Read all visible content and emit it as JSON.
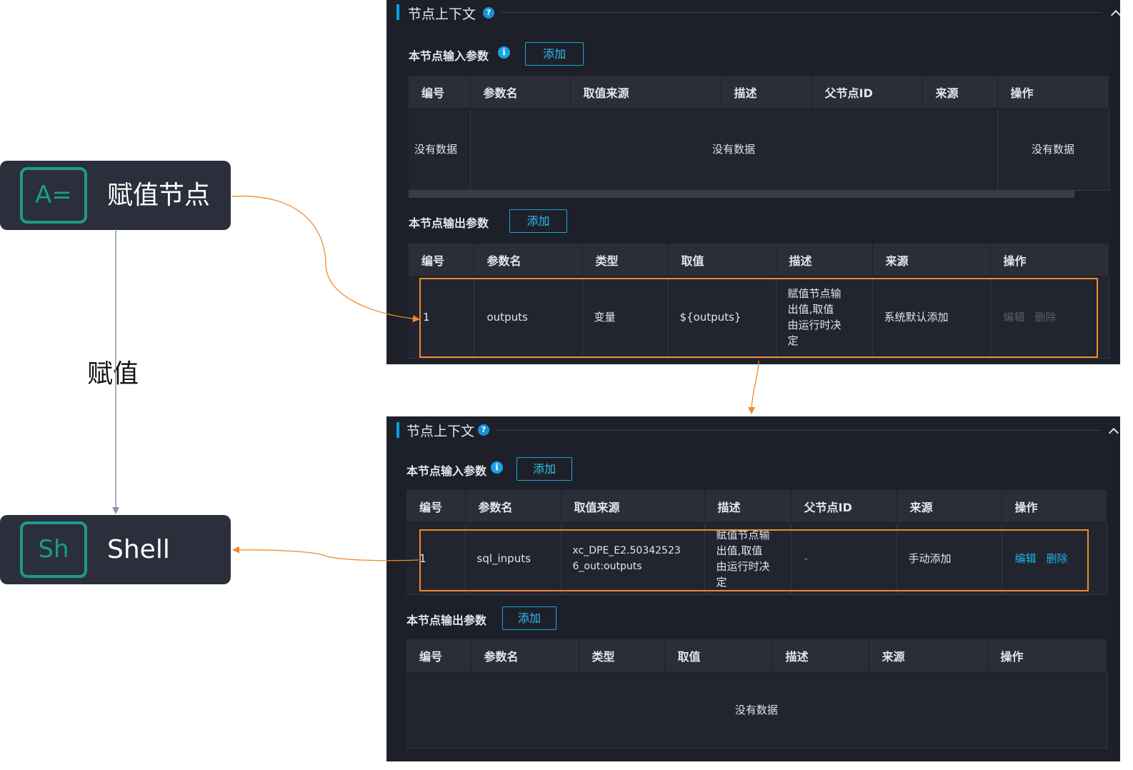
{
  "flow": {
    "node_assign": {
      "icon_text": "A=",
      "label": "赋值节点"
    },
    "node_shell": {
      "icon_text": "Sh",
      "label": "Shell"
    },
    "edge_label": "赋值"
  },
  "colors": {
    "panel_bg": "#1e2029",
    "accent": "#19b4ee",
    "highlight": "#f08a2c",
    "node_teal": "#1e9a8a"
  },
  "icons": [
    "help-icon",
    "info-icon",
    "collapse-up-icon"
  ],
  "top_panel": {
    "title": "节点上下文",
    "input_section": {
      "label": "本节点输入参数",
      "add_label": "添加",
      "columns": [
        "编号",
        "参数名",
        "取值来源",
        "描述",
        "父节点ID",
        "来源",
        "操作"
      ],
      "empty_row": [
        "没有数据",
        "没有数据",
        "没有数据"
      ]
    },
    "output_section": {
      "label": "本节点输出参数",
      "add_label": "添加",
      "columns": [
        "编号",
        "参数名",
        "类型",
        "取值",
        "描述",
        "来源",
        "操作"
      ],
      "rows": [
        {
          "id": "1",
          "name": "outputs",
          "type": "变量",
          "value": "${outputs}",
          "desc": "赋值节点输出值,取值由运行时决定",
          "source": "系统默认添加",
          "edit": "编辑",
          "delete": "删除"
        }
      ]
    }
  },
  "bottom_panel": {
    "title": "节点上下文",
    "input_section": {
      "label": "本节点输入参数",
      "add_label": "添加",
      "columns": [
        "编号",
        "参数名",
        "取值来源",
        "描述",
        "父节点ID",
        "来源",
        "操作"
      ],
      "rows": [
        {
          "id": "1",
          "name": "sql_inputs",
          "value_source": "xc_DPE_E2.503425236_out:outputs",
          "desc": "赋值节点输出值,取值由运行时决定",
          "parent_id": "-",
          "source": "手动添加",
          "edit": "编辑",
          "delete": "删除"
        }
      ]
    },
    "output_section": {
      "label": "本节点输出参数",
      "add_label": "添加",
      "columns": [
        "编号",
        "参数名",
        "类型",
        "取值",
        "描述",
        "来源",
        "操作"
      ],
      "empty_text": "没有数据"
    }
  }
}
